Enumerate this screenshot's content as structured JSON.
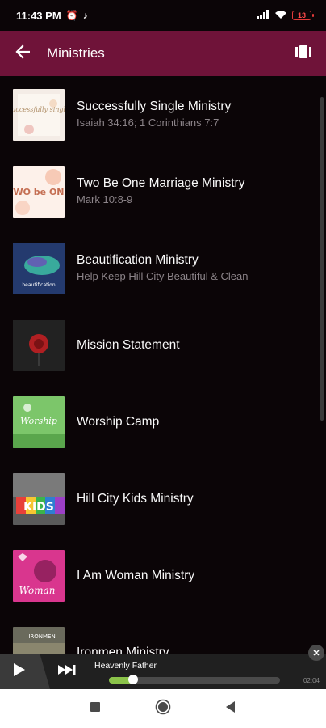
{
  "status_bar": {
    "time": "11:43 PM",
    "alarm_icon": "alarm-clock-icon",
    "music_icon": "music-note-icon",
    "battery_level": "13"
  },
  "app_bar": {
    "title": "Ministries",
    "back_icon": "arrow-back-icon",
    "action_icon": "view-carousel-icon"
  },
  "ministries": [
    {
      "title": "Successfully Single Ministry",
      "subtitle": "Isaiah 34:16; 1 Corinthians 7:7",
      "thumb_text": "successfully single",
      "thumb_bg": "#f4ece6",
      "thumb_fg": "#c8a87a"
    },
    {
      "title": "Two Be One Marriage Ministry",
      "subtitle": "Mark 10:8-9",
      "thumb_text": "TWO be ONE",
      "thumb_bg": "#fdf1ea",
      "thumb_fg": "#d98c6b"
    },
    {
      "title": "Beautification Ministry",
      "subtitle": "Help Keep Hill City Beautiful & Clean",
      "thumb_text": "beautification",
      "thumb_bg": "#243a6e",
      "thumb_fg": "#3ec7a8"
    },
    {
      "title": "Mission Statement",
      "subtitle": "",
      "thumb_text": "",
      "thumb_bg": "#1b1b1b",
      "thumb_fg": "#b01f22"
    },
    {
      "title": "Worship Camp",
      "subtitle": "",
      "thumb_text": "Worship",
      "thumb_bg": "#7cc66a",
      "thumb_fg": "#ffffff"
    },
    {
      "title": "Hill City Kids Ministry",
      "subtitle": "",
      "thumb_text": "KIDS",
      "thumb_bg": "#5a5a5a",
      "thumb_fg": "#ffffff"
    },
    {
      "title": "I Am Woman Ministry",
      "subtitle": "",
      "thumb_text": "Woman",
      "thumb_bg": "#d9368e",
      "thumb_fg": "#ffffff"
    },
    {
      "title": "Ironmen Ministry",
      "subtitle": "",
      "thumb_text": "IRONMEN",
      "thumb_bg": "#6a6a5c",
      "thumb_fg": "#ffffff"
    }
  ],
  "player": {
    "track_title": "Heavenly Father",
    "elapsed": "02:04",
    "progress": 0.14,
    "play_icon": "play-icon",
    "next_icon": "skip-next-icon",
    "close_icon": "close-icon"
  },
  "nav_bar": {
    "recents_icon": "recents-square-icon",
    "home_icon": "home-circle-icon",
    "back_icon": "back-triangle-icon"
  },
  "colors": {
    "app_bar": "#6f1339",
    "background": "#0b0507",
    "progress": "#8bc34a"
  }
}
